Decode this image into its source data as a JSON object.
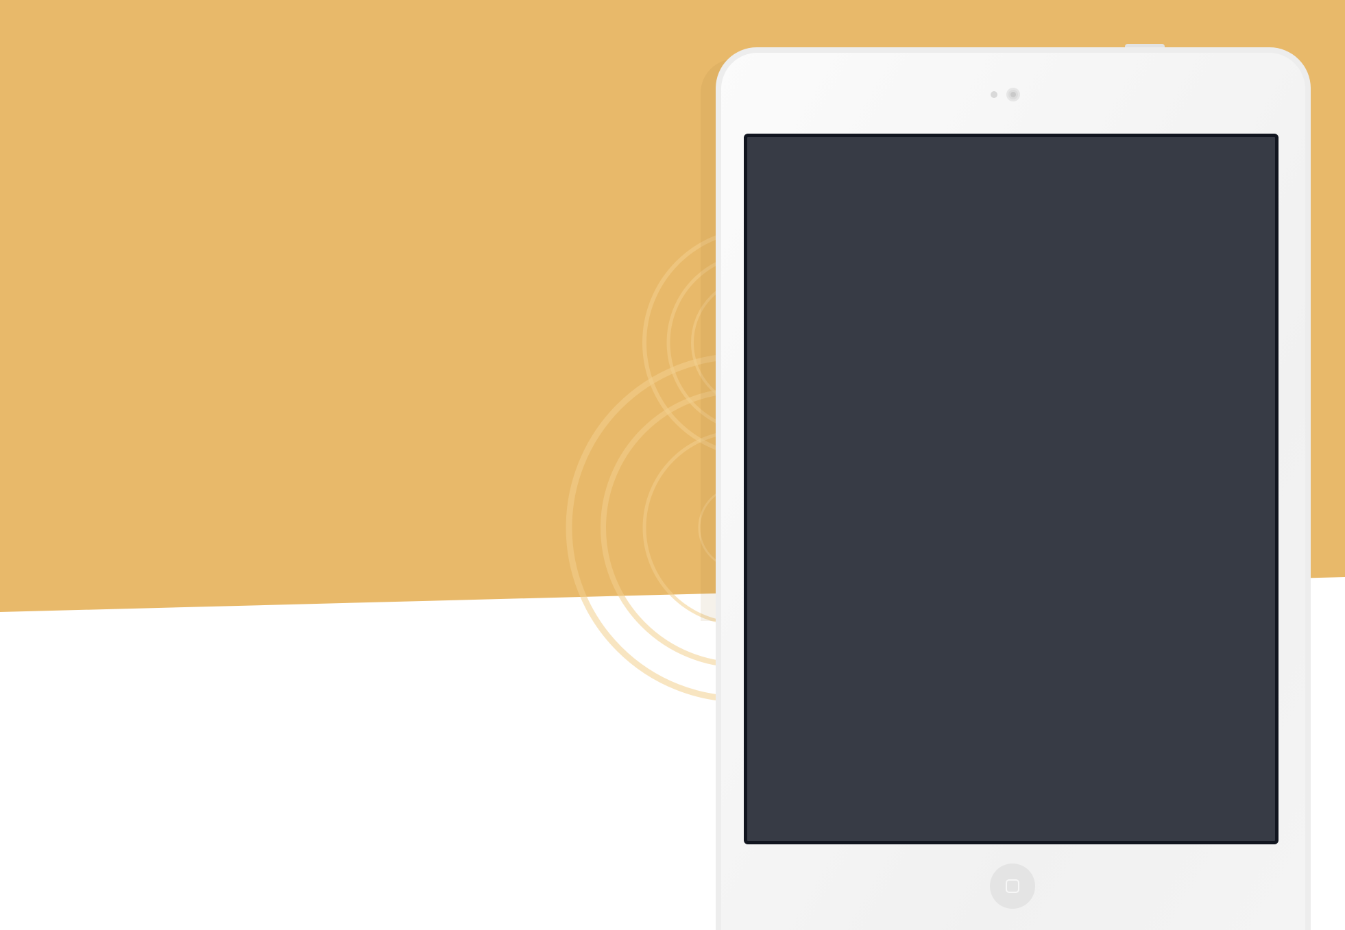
{
  "scene": {
    "description_colors": {
      "banner": "#e8b96a",
      "page": "#ffffff",
      "tablet_frame": "#ededed",
      "tablet_face": "#f6f6f6",
      "screen": "#373b45",
      "screen_border": "#11151f"
    },
    "icons": {
      "camera": "camera-icon",
      "home": "home-button-icon"
    }
  }
}
